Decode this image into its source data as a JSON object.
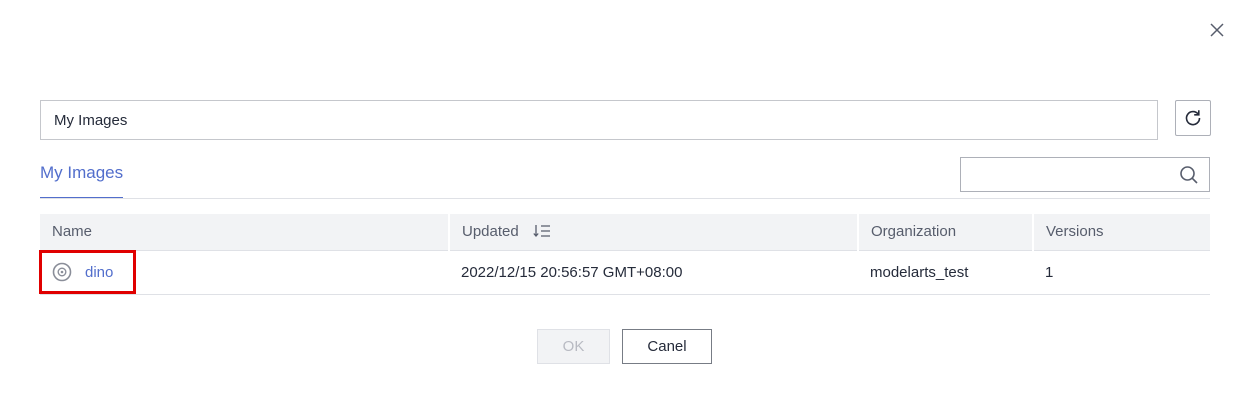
{
  "dialog": {
    "close_icon": "close-icon"
  },
  "source_select": {
    "value": "My Images"
  },
  "refresh": {
    "icon": "refresh-icon"
  },
  "tabs": [
    {
      "label": "My Images",
      "active": true
    }
  ],
  "search": {
    "value": "",
    "placeholder": "",
    "icon": "search-icon"
  },
  "table": {
    "columns": [
      {
        "label": "Name"
      },
      {
        "label": "Updated",
        "sort_icon": "sort-descending-icon"
      },
      {
        "label": "Organization"
      },
      {
        "label": "Versions"
      }
    ],
    "rows": [
      {
        "name": "dino",
        "icon": "image-icon",
        "updated": "2022/12/15 20:56:57 GMT+08:00",
        "organization": "modelarts_test",
        "versions": "1"
      }
    ]
  },
  "footer": {
    "ok_label": "OK",
    "cancel_label": "Canel"
  },
  "colors": {
    "accent": "#526ecc",
    "highlight": "#e00000",
    "header_bg": "#f2f3f5",
    "border": "#dfe1e6"
  }
}
